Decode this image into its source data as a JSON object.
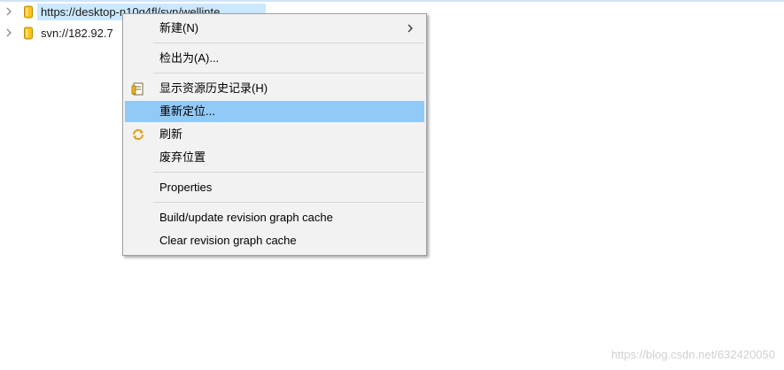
{
  "tree": {
    "items": [
      {
        "label": "https://desktop-n10g4fl/svn/wellinte",
        "icon": "repository-icon"
      },
      {
        "label": "svn://182.92.7",
        "icon": "repository-icon"
      }
    ]
  },
  "context_menu": {
    "items": [
      {
        "label": "新建(N)",
        "has_submenu": true
      },
      {
        "label": "检出为(A)..."
      },
      {
        "label": "显示资源历史记录(H)",
        "icon": "history-icon"
      },
      {
        "label": "重新定位...",
        "highlighted": true
      },
      {
        "label": "刷新",
        "icon": "refresh-icon"
      },
      {
        "label": "废弃位置"
      },
      {
        "label": "Properties"
      },
      {
        "label": "Build/update revision graph cache"
      },
      {
        "label": "Clear revision graph cache"
      }
    ]
  },
  "watermark": "https://blog.csdn.net/632420050",
  "colors": {
    "selection": "#cce8ff",
    "menu_highlight": "#91c9f7",
    "menu_background": "#f2f2f2",
    "repository_icon": "#f4b400"
  }
}
